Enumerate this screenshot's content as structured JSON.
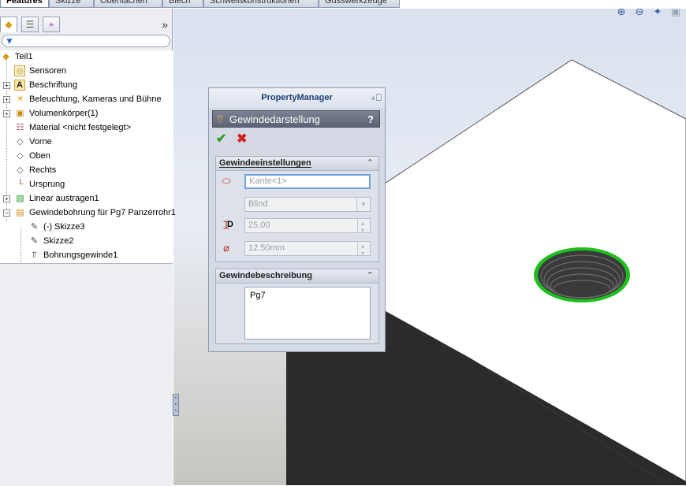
{
  "command_tabs": [
    "Features",
    "Skizze",
    "Oberflächen",
    "Blech",
    "Schweißkonstruktionen",
    "Gusswerkzeuge"
  ],
  "feature_tree": {
    "nodes": [
      {
        "label": "Teil1",
        "icon": "part-icon"
      },
      {
        "label": "Sensoren",
        "icon": "sensor-icon"
      },
      {
        "label": "Beschriftung",
        "icon": "annotation-icon"
      },
      {
        "label": "Beleuchtung, Kameras und Bühne",
        "icon": "lights-icon"
      },
      {
        "label": "Volumenkörper(1)",
        "icon": "solid-bodies-icon"
      },
      {
        "label": "Material <nicht festgelegt>",
        "icon": "material-icon"
      },
      {
        "label": "Vorne",
        "icon": "plane-icon"
      },
      {
        "label": "Oben",
        "icon": "plane-icon"
      },
      {
        "label": "Rechts",
        "icon": "plane-icon"
      },
      {
        "label": "Ursprung",
        "icon": "origin-icon"
      },
      {
        "label": "Linear austragen1",
        "icon": "extrude-icon"
      },
      {
        "label": "Gewindebohrung für Pg7 Panzerrohr1",
        "icon": "hole-icon"
      },
      {
        "label": "(-) Skizze3",
        "icon": "sketch-icon"
      },
      {
        "label": "Skizze2",
        "icon": "sketch-icon"
      },
      {
        "label": "Bohrungsgewinde1",
        "icon": "thread-icon"
      }
    ]
  },
  "property_manager": {
    "header": "PropertyManager",
    "feature_title": "Gewindedarstellung",
    "help": "?",
    "settings_group": {
      "title": "Gewindeeinstellungen",
      "edge_value": "Kante<1>",
      "end_condition": "Blind",
      "depth_label": "D",
      "depth_value": "25.00",
      "diameter_value": "12.50mm"
    },
    "description_group": {
      "title": "Gewindebeschreibung",
      "text": "Pg7"
    }
  },
  "colors": {
    "selection_highlight": "#1fbf1f",
    "ok": "#2f9a22",
    "cancel": "#d32020",
    "pm_title": "#1d3e77"
  }
}
